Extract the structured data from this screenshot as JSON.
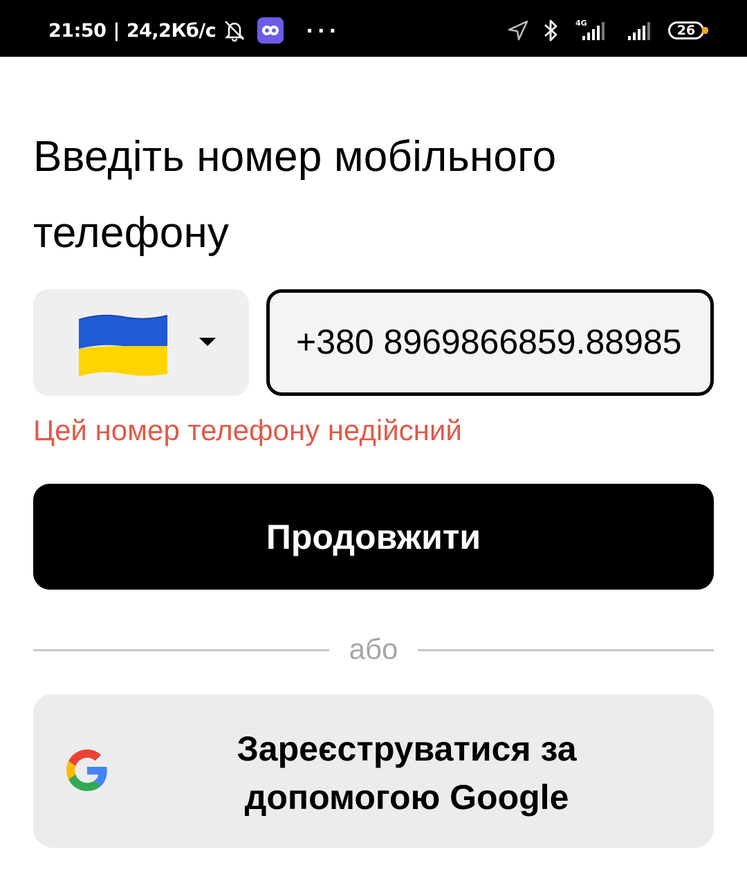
{
  "status_bar": {
    "time": "21:50",
    "network_speed": "24,2Кб/с",
    "battery": "26",
    "network_type": "4G",
    "icons": [
      "bell-muted-icon",
      "app-badge-icon",
      "more-dots-icon",
      "location-arrow-icon",
      "bluetooth-icon",
      "signal-icon",
      "battery-icon"
    ]
  },
  "page": {
    "title": "Введіть номер мобільного телефону"
  },
  "phone_form": {
    "country_flag": "ukraine-flag-icon",
    "phone_value": "+380 8969866859.88985",
    "error_message": "Цей номер телефону недійсний",
    "error_color": "#e05a48"
  },
  "actions": {
    "continue_label": "Продовжити",
    "or_label": "або",
    "google_signup_label": "Зареєструватися за допомогою Google"
  }
}
